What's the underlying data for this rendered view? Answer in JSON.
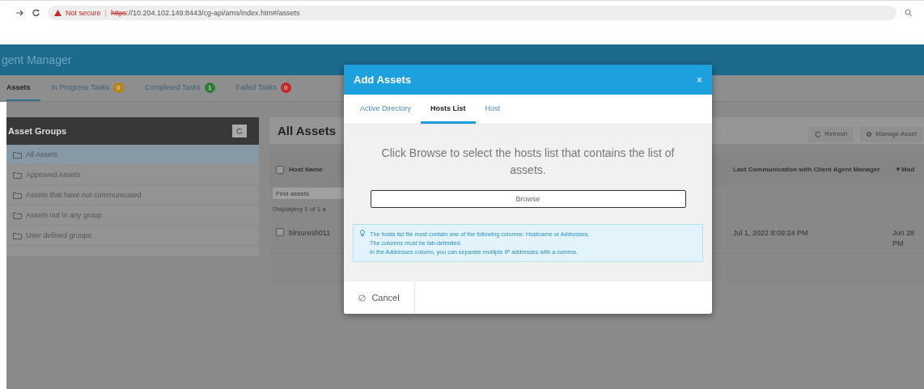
{
  "browser": {
    "security": "Not secure",
    "separator": "|",
    "url_scheme": "https",
    "url_rest": "://10.204.102.149:8443/cg-api/ams/index.htm#/assets"
  },
  "app": {
    "title": "gent Manager"
  },
  "nav_tabs": [
    {
      "label": "Assets",
      "selected": true
    },
    {
      "label": "In Progress Tasks",
      "selected": false,
      "count": "0",
      "color": "#b8860b"
    },
    {
      "label": "Completed Tasks",
      "selected": false,
      "count": "1",
      "color": "#2e7d32"
    },
    {
      "label": "Failed Tasks",
      "selected": false,
      "count": "0",
      "color": "#c62828"
    }
  ],
  "asset_groups": {
    "title": "Asset Groups",
    "items": [
      {
        "label": "All Assets",
        "selected": true
      },
      {
        "label": "Approved Assets",
        "selected": false
      },
      {
        "label": "Assets that have not communicated",
        "selected": false
      },
      {
        "label": "Assets not in any group",
        "selected": false
      },
      {
        "label": "User defined groups",
        "selected": false
      }
    ]
  },
  "main": {
    "title": "All Assets",
    "buttons": [
      "Refresh",
      "Manage Asset"
    ],
    "header_checked": false,
    "columns": [
      "Host Name",
      "Last Communication with Client Agent Manager",
      "▼Mod"
    ],
    "filter_placeholder": "Find assets",
    "summary": "Displaying 1 of 1 a",
    "rows": [
      {
        "checked": false,
        "cells": [
          "blrsuresh011",
          "Jul 1, 2022 8:09:24 PM",
          "Jun 28 PM"
        ]
      }
    ]
  },
  "modal": {
    "title": "Add Assets",
    "close": "×",
    "tabs": [
      {
        "label": "Active Directory",
        "selected": false
      },
      {
        "label": "Hosts List",
        "selected": true
      },
      {
        "label": "Host",
        "selected": false
      }
    ],
    "instruction": "Click Browse to select the hosts list that contains the list of assets.",
    "browse": "Browse",
    "note_lines": [
      "The hosts list file must contain one of the following columns: Hostname or Addresses.",
      "The columns must be tab-delimited.",
      "In the Addresses column, you can separate multiple IP addresses with a comma."
    ],
    "cancel": "Cancel"
  }
}
